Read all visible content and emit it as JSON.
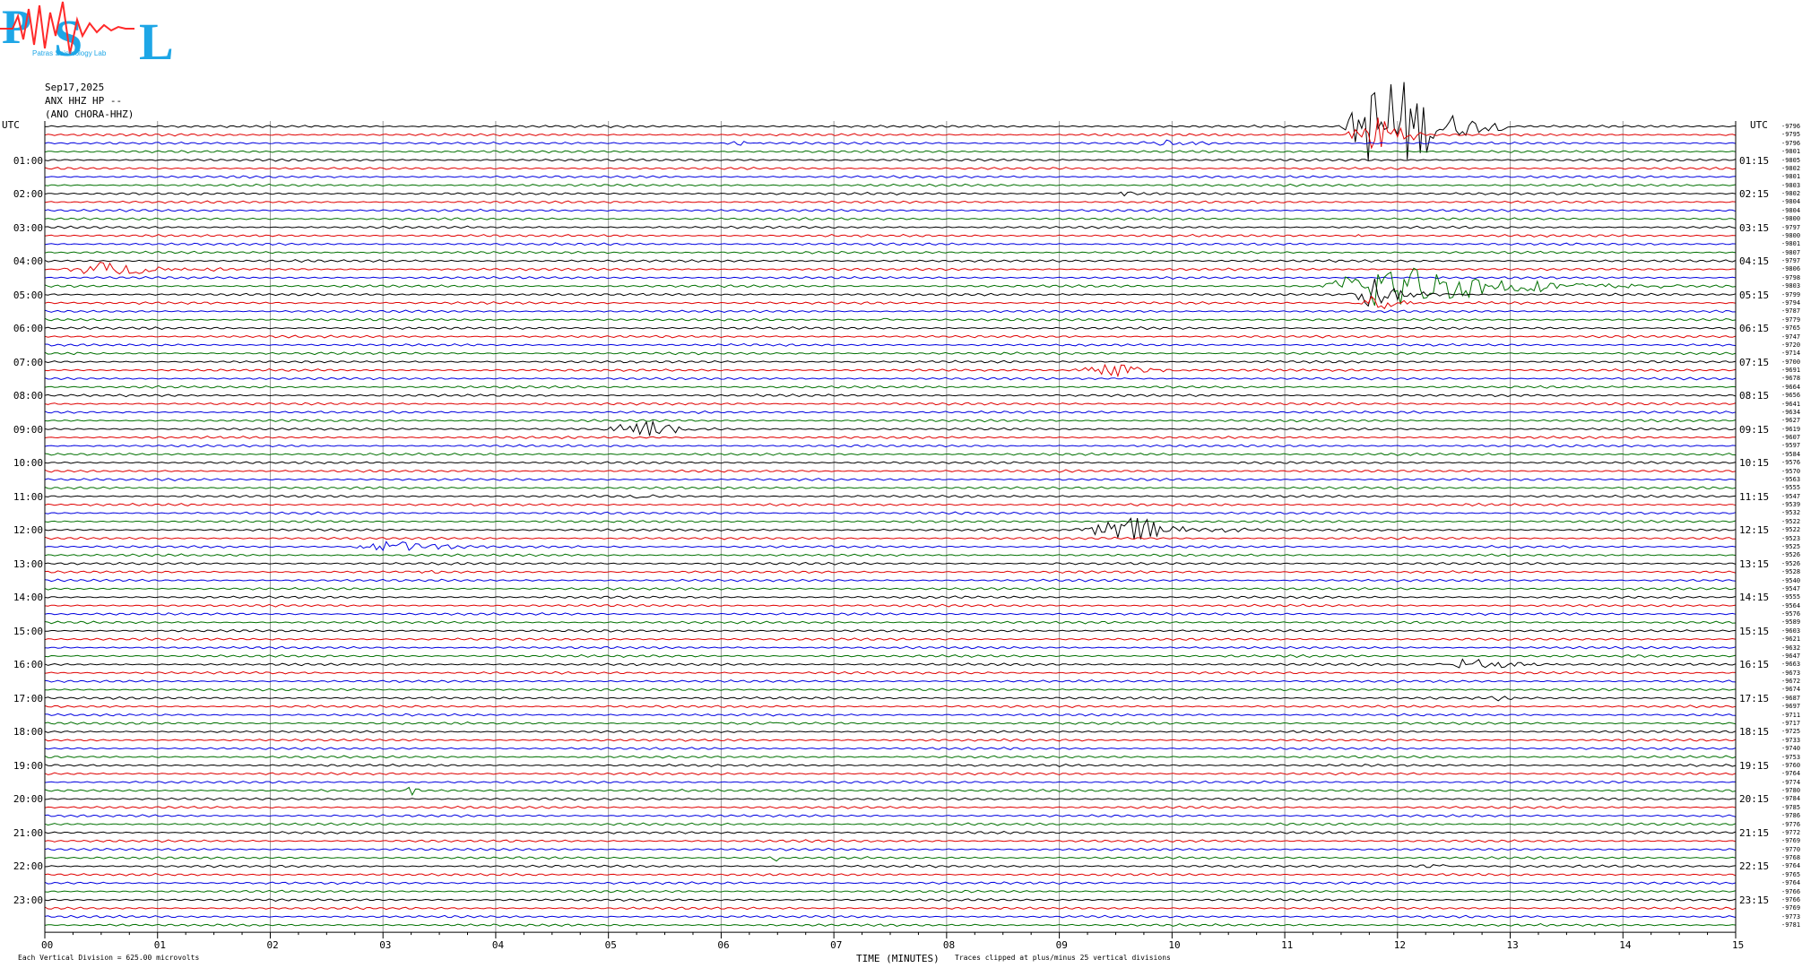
{
  "header": {
    "logo_text": "PSL",
    "logo_subtext": "Patras Seismology Lab",
    "date": "Sep17,2025",
    "station": "ANX HHZ HP --",
    "location": "(ANO CHORA-HHZ)"
  },
  "axes": {
    "left_utc_label": "UTC",
    "right_utc_label": "UTC",
    "xlabel": "TIME (MINUTES)",
    "x_ticks": [
      "00",
      "01",
      "02",
      "03",
      "04",
      "05",
      "06",
      "07",
      "08",
      "09",
      "10",
      "11",
      "12",
      "13",
      "14",
      "15"
    ],
    "left_hours": [
      "01:00",
      "02:00",
      "03:00",
      "04:00",
      "05:00",
      "06:00",
      "07:00",
      "08:00",
      "09:00",
      "10:00",
      "11:00",
      "12:00",
      "13:00",
      "14:00",
      "15:00",
      "16:00",
      "17:00",
      "18:00",
      "19:00",
      "20:00",
      "21:00",
      "22:00",
      "23:00"
    ],
    "right_hours": [
      "01:15",
      "02:15",
      "03:15",
      "04:15",
      "05:15",
      "06:15",
      "07:15",
      "08:15",
      "09:15",
      "10:15",
      "11:15",
      "12:15",
      "13:15",
      "14:15",
      "15:15",
      "16:15",
      "17:15",
      "18:15",
      "19:15",
      "20:15",
      "21:15",
      "22:15",
      "23:15"
    ]
  },
  "footer": {
    "scale_note": "Each Vertical Division =  625.00 microvolts",
    "clip_note": "Traces clipped at plus/minus 25 vertical divisions"
  },
  "colors": {
    "trace_cycle": [
      "#000000",
      "#e00000",
      "#0000e0",
      "#007000"
    ],
    "grid": "#999999",
    "logo_cyan": "#1ea6e6",
    "logo_red": "#ff2a2a"
  },
  "chart_data": {
    "type": "line",
    "title": "",
    "xlabel": "TIME (MINUTES)",
    "ylabel": "UTC",
    "xlim": [
      0,
      15
    ],
    "rows": 96,
    "row_interval_minutes": 15,
    "right_values": [
      -9796,
      -9795,
      -9796,
      -9801,
      -9805,
      -9802,
      -9801,
      -9803,
      -9802,
      -9804,
      -9804,
      -9800,
      -9797,
      -9800,
      -9801,
      -9807,
      -9797,
      -9806,
      -9798,
      -9803,
      -9799,
      -9794,
      -9787,
      -9779,
      -9765,
      -9747,
      -9720,
      -9714,
      -9700,
      -9691,
      -9678,
      -9664,
      -9656,
      -9641,
      -9634,
      -9627,
      -9619,
      -9607,
      -9597,
      -9584,
      -9576,
      -9570,
      -9563,
      -9555,
      -9547,
      -9539,
      -9532,
      -9522,
      -9522,
      -9523,
      -9525,
      -9526,
      -9526,
      -9528,
      -9540,
      -9547,
      -9555,
      -9564,
      -9576,
      -9589,
      -9603,
      -9621,
      -9632,
      -9647,
      -9663,
      -9673,
      -9672,
      -9674,
      -9687,
      -9697,
      -9711,
      -9717,
      -9725,
      -9733,
      -9740,
      -9753,
      -9760,
      -9764,
      -9774,
      -9780,
      -9784,
      -9785,
      -9786,
      -9776,
      -9772,
      -9769,
      -9770,
      -9768,
      -9764,
      -9765,
      -9764,
      -9766,
      -9766,
      -9769,
      -9773,
      -9781
    ],
    "events": [
      {
        "row": 0,
        "start_min": 11.5,
        "end_min": 13.0,
        "peak_min": 11.95,
        "amplitude": 75
      },
      {
        "row": 1,
        "start_min": 11.5,
        "end_min": 12.3,
        "peak_min": 11.95,
        "amplitude": 30
      },
      {
        "row": 2,
        "start_min": 6.0,
        "end_min": 6.6,
        "peak_min": 6.2,
        "amplitude": 2
      },
      {
        "row": 2,
        "start_min": 9.6,
        "end_min": 10.6,
        "peak_min": 10.0,
        "amplitude": 3
      },
      {
        "row": 8,
        "start_min": 9.4,
        "end_min": 9.9,
        "peak_min": 9.6,
        "amplitude": 2
      },
      {
        "row": 13,
        "start_min": 11.5,
        "end_min": 12.0,
        "peak_min": 11.7,
        "amplitude": 1.5
      },
      {
        "row": 17,
        "start_min": 0.1,
        "end_min": 1.8,
        "peak_min": 0.55,
        "amplitude": 9
      },
      {
        "row": 19,
        "start_min": 11.3,
        "end_min": 14.5,
        "peak_min": 11.9,
        "amplitude": 30
      },
      {
        "row": 20,
        "start_min": 11.5,
        "end_min": 12.5,
        "peak_min": 11.8,
        "amplitude": 18
      },
      {
        "row": 21,
        "start_min": 11.6,
        "end_min": 12.3,
        "peak_min": 11.85,
        "amplitude": 12
      },
      {
        "row": 23,
        "start_min": 7.3,
        "end_min": 7.6,
        "peak_min": 7.45,
        "amplitude": 3
      },
      {
        "row": 27,
        "start_min": 0.2,
        "end_min": 0.6,
        "peak_min": 0.35,
        "amplitude": 2
      },
      {
        "row": 29,
        "start_min": 9.1,
        "end_min": 10.2,
        "peak_min": 9.5,
        "amplitude": 9
      },
      {
        "row": 36,
        "start_min": 4.9,
        "end_min": 6.0,
        "peak_min": 5.4,
        "amplitude": 12
      },
      {
        "row": 44,
        "start_min": 5.1,
        "end_min": 5.7,
        "peak_min": 5.3,
        "amplitude": 2
      },
      {
        "row": 48,
        "start_min": 9.1,
        "end_min": 10.9,
        "peak_min": 9.65,
        "amplitude": 16
      },
      {
        "row": 50,
        "start_min": 2.7,
        "end_min": 4.1,
        "peak_min": 3.15,
        "amplitude": 8
      },
      {
        "row": 53,
        "start_min": 3.2,
        "end_min": 3.7,
        "peak_min": 3.4,
        "amplitude": 2
      },
      {
        "row": 64,
        "start_min": 12.3,
        "end_min": 13.6,
        "peak_min": 12.7,
        "amplitude": 8
      },
      {
        "row": 68,
        "start_min": 12.8,
        "end_min": 13.2,
        "peak_min": 12.95,
        "amplitude": 6
      },
      {
        "row": 71,
        "start_min": 6.3,
        "end_min": 6.9,
        "peak_min": 6.5,
        "amplitude": 2
      },
      {
        "row": 79,
        "start_min": 3.2,
        "end_min": 3.4,
        "peak_min": 3.25,
        "amplitude": 9
      },
      {
        "row": 87,
        "start_min": 6.4,
        "end_min": 6.6,
        "peak_min": 6.5,
        "amplitude": 4
      },
      {
        "row": 88,
        "start_min": 12.0,
        "end_min": 12.8,
        "peak_min": 12.4,
        "amplitude": 2
      }
    ],
    "grid": true
  }
}
